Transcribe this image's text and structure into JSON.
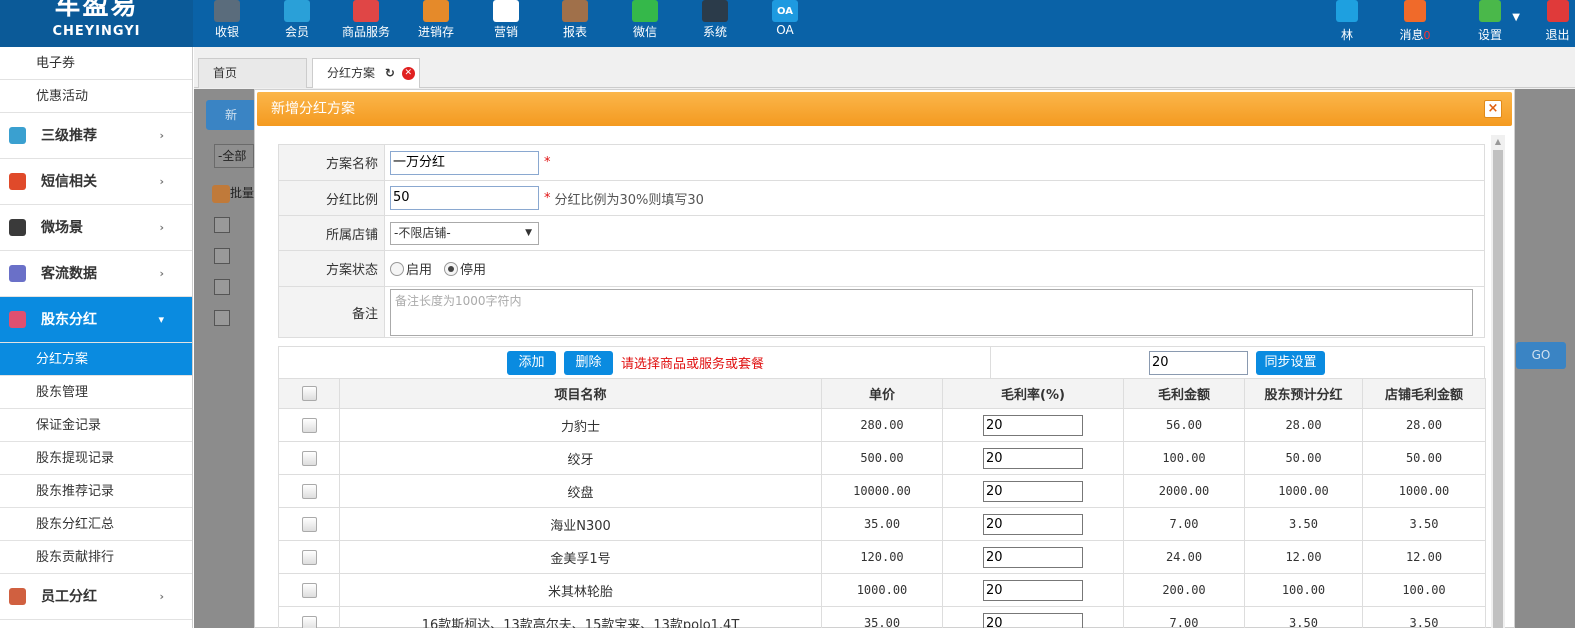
{
  "app": {
    "logo_cn": "车盈易",
    "logo_en": "CHEYINGYI"
  },
  "topnav": [
    {
      "label": "收银",
      "icon": "cash-register-icon",
      "color": "#5a6c7c"
    },
    {
      "label": "会员",
      "icon": "member-icon",
      "color": "#2aa0d8"
    },
    {
      "label": "商品服务",
      "icon": "goods-service-icon",
      "color": "#e04646"
    },
    {
      "label": "进销存",
      "icon": "inventory-icon",
      "color": "#e58a2a"
    },
    {
      "label": "营销",
      "icon": "megaphone-icon",
      "color": "#ffffff"
    },
    {
      "label": "报表",
      "icon": "report-icon",
      "color": "#a0704a"
    },
    {
      "label": "微信",
      "icon": "wechat-icon",
      "color": "#35b84a"
    },
    {
      "label": "系统",
      "icon": "monitor-icon",
      "color": "#2b3b4a"
    },
    {
      "label": "OA",
      "icon": "oa-icon",
      "color": "#1e9ae0",
      "glyph": "OA"
    }
  ],
  "topright": {
    "user": "林",
    "messages": "消息",
    "messages_count": "0",
    "settings": "设置",
    "logout": "退出"
  },
  "sidebar": {
    "top_subs": [
      "电子券",
      "优惠活动"
    ],
    "groups_before": [
      {
        "label": "三级推荐",
        "icon": "layers-icon",
        "color": "#3aa0d0"
      },
      {
        "label": "短信相关",
        "icon": "phone-icon",
        "color": "#e04a2a"
      },
      {
        "label": "微场景",
        "icon": "mobile-icon",
        "color": "#3a3a3a"
      },
      {
        "label": "客流数据",
        "icon": "traffic-data-icon",
        "color": "#6a70c8"
      }
    ],
    "active_group": {
      "label": "股东分红",
      "icon": "dividend-doc-icon",
      "color": "#e05070"
    },
    "active_subs": [
      "分红方案",
      "股东管理",
      "保证金记录",
      "股东提现记录",
      "股东推荐记录",
      "股东分红汇总",
      "股东贡献排行"
    ],
    "active_sub_index": 0,
    "group_after": {
      "label": "员工分红",
      "icon": "staff-icon",
      "color": "#d06040"
    }
  },
  "tabs": [
    {
      "label": "首页"
    },
    {
      "label": "分红方案"
    }
  ],
  "background": {
    "new_btn": "新",
    "filter": "-全部",
    "batch": "批量",
    "go": "GO"
  },
  "modal": {
    "title": "新增分红方案",
    "close": "×",
    "form": {
      "name_label": "方案名称",
      "name_value": "一万分红",
      "ratio_label": "分红比例",
      "ratio_value": "50",
      "ratio_hint": "分红比例为30%则填写30",
      "required_mark": "*",
      "store_label": "所属店铺",
      "store_value": "-不限店铺-",
      "status_label": "方案状态",
      "status_options": [
        "启用",
        "停用"
      ],
      "status_selected": "停用",
      "remark_label": "备注",
      "remark_placeholder": "备注长度为1000字符内"
    },
    "toolbar": {
      "add": "添加",
      "delete": "删除",
      "tip": "请选择商品或服务或套餐",
      "sync_value": "20",
      "sync": "同步设置"
    },
    "table": {
      "headers": [
        "项目名称",
        "单价",
        "毛利率(%)",
        "毛利金额",
        "股东预计分红",
        "店铺毛利金额"
      ],
      "rows": [
        {
          "name": "力豹士",
          "price": "280.00",
          "rate": "20",
          "profit": "56.00",
          "holder": "28.00",
          "store": "28.00"
        },
        {
          "name": "绞牙",
          "price": "500.00",
          "rate": "20",
          "profit": "100.00",
          "holder": "50.00",
          "store": "50.00"
        },
        {
          "name": "绞盘",
          "price": "10000.00",
          "rate": "20",
          "profit": "2000.00",
          "holder": "1000.00",
          "store": "1000.00"
        },
        {
          "name": "海业N300",
          "price": "35.00",
          "rate": "20",
          "profit": "7.00",
          "holder": "3.50",
          "store": "3.50"
        },
        {
          "name": "金美孚1号",
          "price": "120.00",
          "rate": "20",
          "profit": "24.00",
          "holder": "12.00",
          "store": "12.00"
        },
        {
          "name": "米其林轮胎",
          "price": "1000.00",
          "rate": "20",
          "profit": "200.00",
          "holder": "100.00",
          "store": "100.00"
        },
        {
          "name": "16款斯柯达、13款高尔夫、15款宝来、13款polo1.4T",
          "price": "35.00",
          "rate": "20",
          "profit": "7.00",
          "holder": "3.50",
          "store": "3.50"
        }
      ]
    }
  }
}
